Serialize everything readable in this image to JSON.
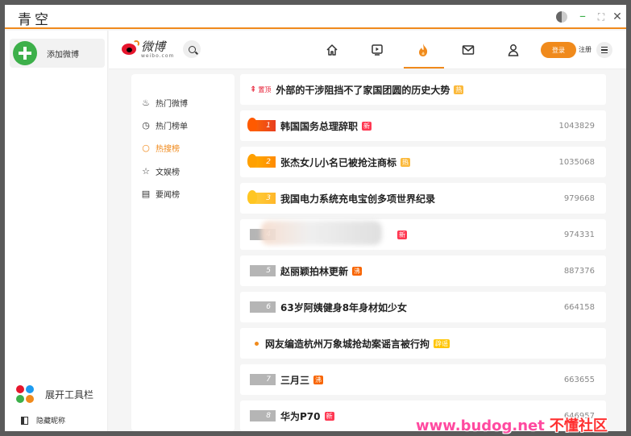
{
  "window": {
    "title": "青空",
    "controls": {
      "theme": "theme-toggle-icon",
      "minimize": "minimize-icon",
      "maximize": "maximize-icon",
      "close": "close-icon"
    }
  },
  "sidebar": {
    "compose_label": "添加微博",
    "toolbar_label": "展开工具栏",
    "hide_nick_label": "隐藏昵称",
    "dot_colors": [
      "#e6162d",
      "#1d9bf0",
      "#3db04a",
      "#f08a1c"
    ]
  },
  "header": {
    "brand_cn": "微博",
    "brand_en": "weibo.com",
    "nav": [
      "home-icon",
      "video-icon",
      "hot-icon",
      "mail-icon",
      "user-icon"
    ],
    "active_nav": "hot-icon",
    "login_label": "登录",
    "register_label": "注册"
  },
  "subnav": {
    "items": [
      {
        "label": "热门微博",
        "icon": "hot-weibo-icon",
        "active": false
      },
      {
        "label": "热门榜单",
        "icon": "clock-icon",
        "active": false
      },
      {
        "label": "热搜榜",
        "icon": "search-icon",
        "active": true
      },
      {
        "label": "文娱榜",
        "icon": "star-icon",
        "active": false
      },
      {
        "label": "要闻榜",
        "icon": "news-icon",
        "active": false
      }
    ]
  },
  "hot_list": {
    "pinned": {
      "label": "置顶",
      "topic": "外部的干涉阻挡不了家国团圆的历史大势",
      "tag": "热"
    },
    "items": [
      {
        "rank": "1",
        "topic": "韩国国务总理辞职",
        "tag": "新",
        "tag_kind": "xin",
        "count": "1043829",
        "style": "fire1"
      },
      {
        "rank": "2",
        "topic": "张杰女儿小名已被抢注商标",
        "tag": "热",
        "tag_kind": "huo",
        "count": "1035068",
        "style": "fire2"
      },
      {
        "rank": "3",
        "topic": "我国电力系统充电宝创多项世界纪录",
        "tag": "",
        "tag_kind": "",
        "count": "979668",
        "style": "fire3"
      },
      {
        "rank": "4",
        "topic": "",
        "tag": "新",
        "tag_kind": "xin",
        "count": "974331",
        "style": "grey",
        "blurred": true
      },
      {
        "rank": "5",
        "topic": "赵丽颖拍林更新",
        "tag": "沸",
        "tag_kind": "fei",
        "count": "887376",
        "style": "grey"
      },
      {
        "rank": "6",
        "topic": "63岁阿姨健身8年身材如少女",
        "tag": "",
        "tag_kind": "",
        "count": "664158",
        "style": "grey"
      },
      {
        "rank": "",
        "topic": "网友编造杭州万象城抢劫案谣言被行拘",
        "tag": "辟谣",
        "tag_kind": "yao",
        "count": "",
        "style": "bullet"
      },
      {
        "rank": "7",
        "topic": "三月三",
        "tag": "沸",
        "tag_kind": "fei",
        "count": "663655",
        "style": "grey"
      },
      {
        "rank": "8",
        "topic": "华为P70",
        "tag": "新",
        "tag_kind": "xin",
        "count": "646957",
        "style": "grey"
      }
    ]
  },
  "watermark": {
    "url": "www.budog.net",
    "cn": "不懂社区"
  }
}
